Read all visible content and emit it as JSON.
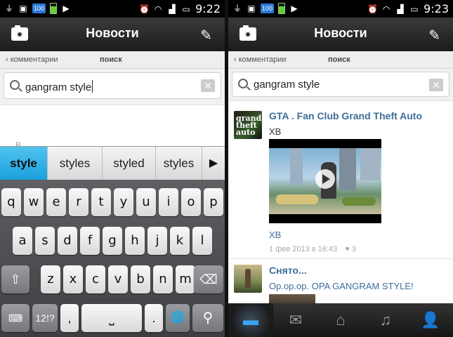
{
  "screens": [
    {
      "status_time": "9:22",
      "badge": "100",
      "title": "Новости",
      "crumb_back": "комментарии",
      "crumb_current": "поиск",
      "search_value": "gangram style",
      "ghost_text": "B",
      "suggestions": [
        "style",
        "styles",
        "styled",
        "styles"
      ],
      "keyboard": {
        "row1": [
          "q",
          "w",
          "e",
          "r",
          "t",
          "y",
          "u",
          "i",
          "o",
          "p"
        ],
        "row2": [
          "a",
          "s",
          "d",
          "f",
          "g",
          "h",
          "j",
          "k",
          "l"
        ],
        "row3": [
          "z",
          "x",
          "c",
          "v",
          "b",
          "n",
          "m"
        ],
        "mode_key": "12!?",
        "comma": ",",
        "period": "."
      }
    },
    {
      "status_time": "9:23",
      "badge": "100",
      "title": "Новости",
      "crumb_back": "комментарии",
      "crumb_current": "поиск",
      "search_value": "gangram style",
      "posts": [
        {
          "title": "GTA . Fan Club Grand Theft Auto",
          "text": "ХВ",
          "caption": "ХВ",
          "date": "1 фев 2013 в 16:43",
          "likes": "3"
        },
        {
          "title": "Снято...",
          "text": "Ор.ор.ор. OPA GANGRAM STYLE!"
        }
      ],
      "tabs": [
        "chat-icon",
        "mail-icon",
        "home-icon",
        "music-icon",
        "profile-icon"
      ]
    }
  ]
}
